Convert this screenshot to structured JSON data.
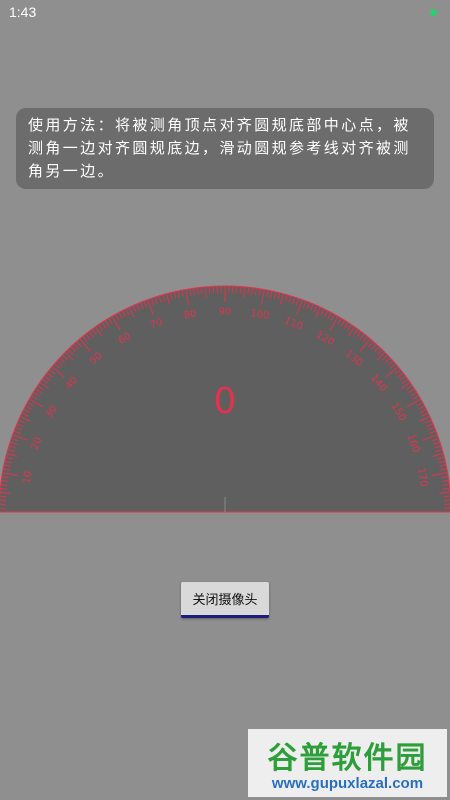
{
  "status_bar": {
    "time": "1:43",
    "indicator_color": "#2ecc71"
  },
  "instructions": {
    "text": "使用方法：将被测角顶点对齐圆规底部中心点，被测角一边对齐圆规底边，滑动圆规参考线对齐被测角另一边。"
  },
  "protractor": {
    "angle_value": "0",
    "scale_labels": [
      "10",
      "20",
      "30",
      "40",
      "50",
      "60",
      "70",
      "80",
      "90",
      "100",
      "110",
      "120",
      "130",
      "140",
      "150",
      "160",
      "170"
    ],
    "accent_color": "#e0344e",
    "face_color": "#5f5f5f"
  },
  "camera_button": {
    "label": "关闭摄像头"
  },
  "watermark": {
    "title": "谷普软件园",
    "url": "www.gupuxlazal.com"
  }
}
